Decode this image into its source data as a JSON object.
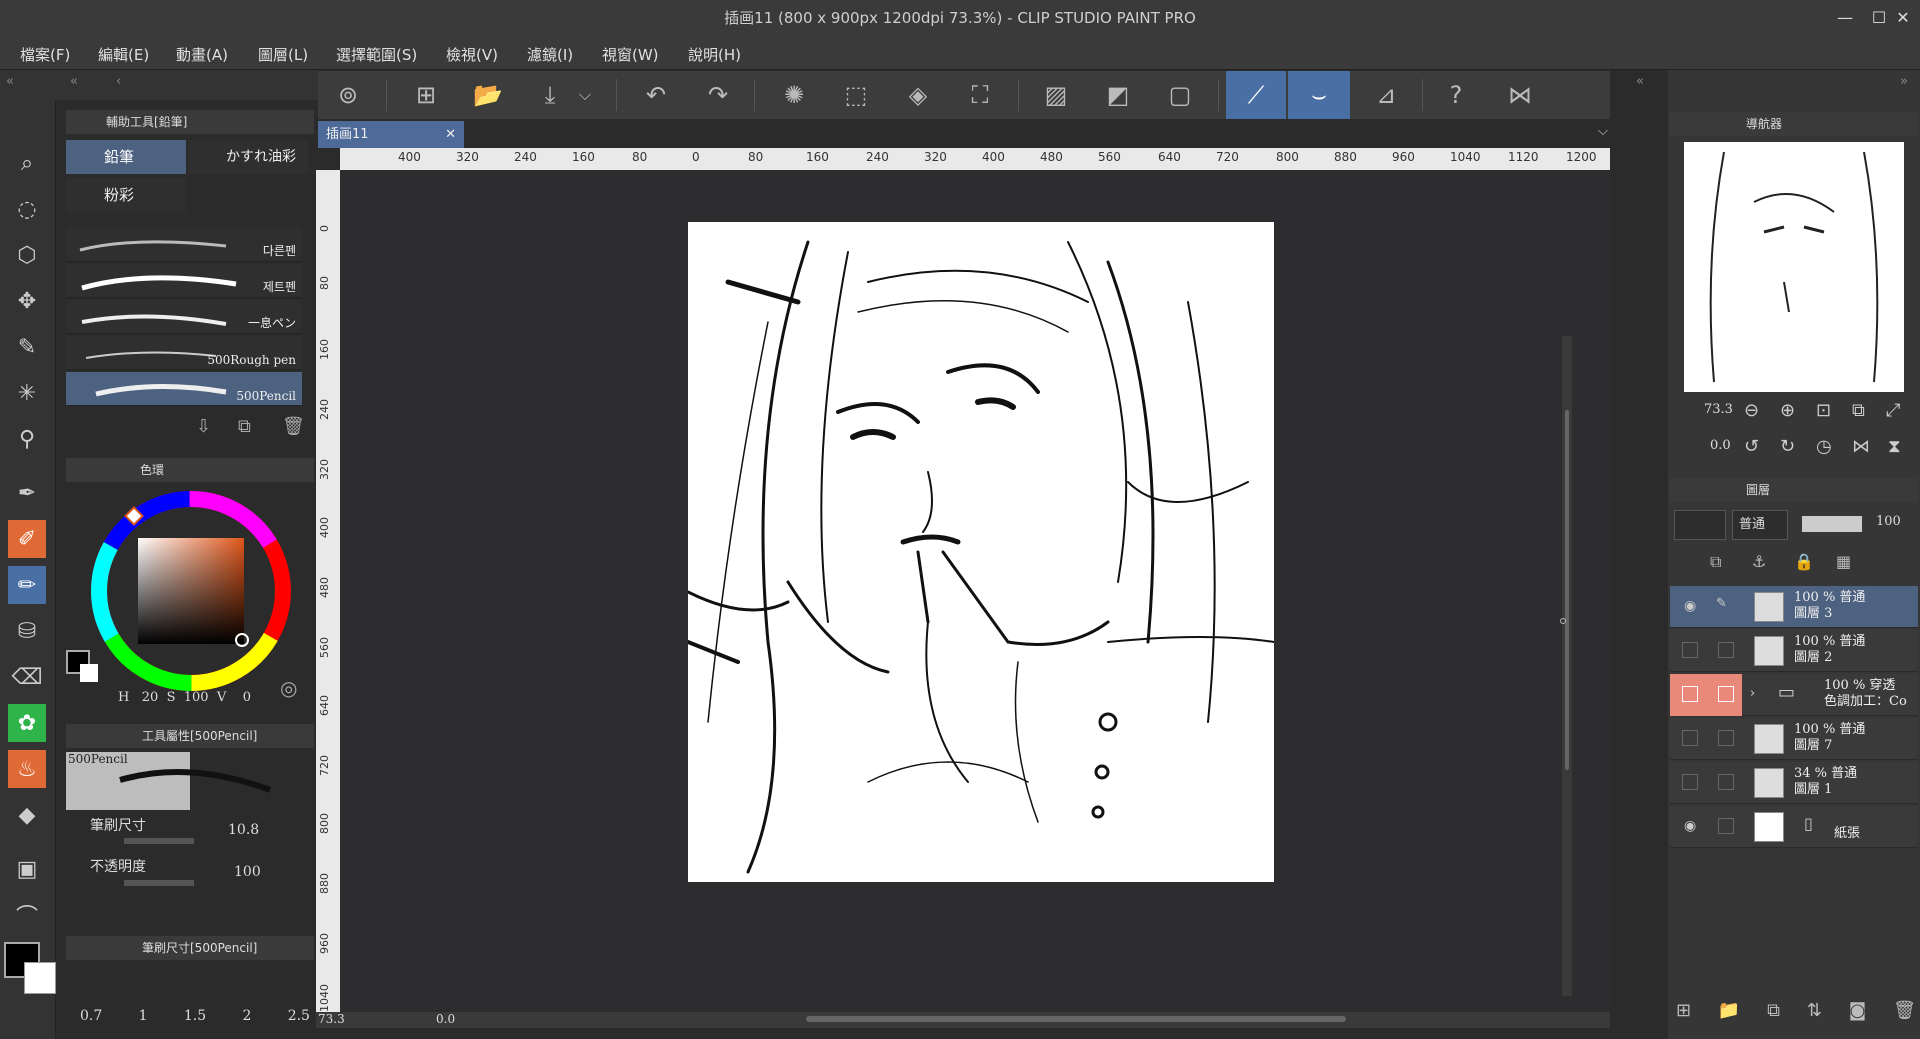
{
  "window": {
    "title": "插画11 (800 x 900px 1200dpi 73.3%) - CLIP STUDIO PAINT PRO"
  },
  "menu": [
    "檔案(F)",
    "編輯(E)",
    "動畫(A)",
    "圖層(L)",
    "選擇範圍(S)",
    "檢視(V)",
    "濾鏡(I)",
    "視窗(W)",
    "說明(H)"
  ],
  "sub_tool": {
    "header": "輔助工具[鉛筆]",
    "tabs": [
      "鉛筆",
      "かすれ油彩",
      "粉彩"
    ],
    "brushes": [
      "다른펜",
      "제트펜",
      "一息ペン",
      "500Rough pen",
      "500Pencil"
    ]
  },
  "color": {
    "header": "色環",
    "h_label": "H",
    "h": "20",
    "s_label": "S",
    "s": "100",
    "v_label": "V",
    "v": "0"
  },
  "tool_property": {
    "header": "工具屬性[500Pencil]",
    "preset": "500Pencil",
    "brush_size_label": "筆刷尺寸",
    "brush_size": "10.8",
    "opacity_label": "不透明度",
    "opacity": "100"
  },
  "brush_size_panel": {
    "header": "筆刷尺寸[500Pencil]",
    "sizes": [
      "0.7",
      "1",
      "1.5",
      "2",
      "2.5"
    ]
  },
  "canvas": {
    "tab": "插画11",
    "ruler_h": [
      "400",
      "320",
      "240",
      "160",
      "80",
      "0",
      "80",
      "160",
      "240",
      "320",
      "400",
      "480",
      "560",
      "640",
      "720",
      "800",
      "880",
      "960",
      "1040",
      "1120",
      "1200"
    ],
    "ruler_v": [
      "0",
      "80",
      "160",
      "240",
      "320",
      "400",
      "480",
      "560",
      "640",
      "720",
      "800",
      "880",
      "960",
      "1040"
    ],
    "zoom": "73.3",
    "rotation": "0.0"
  },
  "navigator": {
    "header": "導航器",
    "zoom": "73.3",
    "angle": "0.0"
  },
  "layers": {
    "header": "圖層",
    "blend": "普通",
    "opacity": "100",
    "items": [
      {
        "line1": "100 % 普通",
        "line2": "圖層 3",
        "selected": true,
        "visible": true
      },
      {
        "line1": "100 % 普通",
        "line2": "圖層 2",
        "selected": false,
        "visible": false
      },
      {
        "line1": "100 % 穿透",
        "line2": "色調加工：Co",
        "selected": false,
        "visible": false,
        "folder": true
      },
      {
        "line1": "100 % 普通",
        "line2": "圖層 7",
        "selected": false,
        "visible": false
      },
      {
        "line1": "34 % 普通",
        "line2": "圖層 1",
        "selected": false,
        "visible": false
      },
      {
        "line1": "",
        "line2": "紙張",
        "selected": false,
        "visible": true,
        "paper": true
      }
    ]
  },
  "colors": {
    "accent": "#4d6180",
    "tab": "#4d6a99",
    "active_tool": "#4a6fa5",
    "folder_mark": "#e8897a"
  }
}
